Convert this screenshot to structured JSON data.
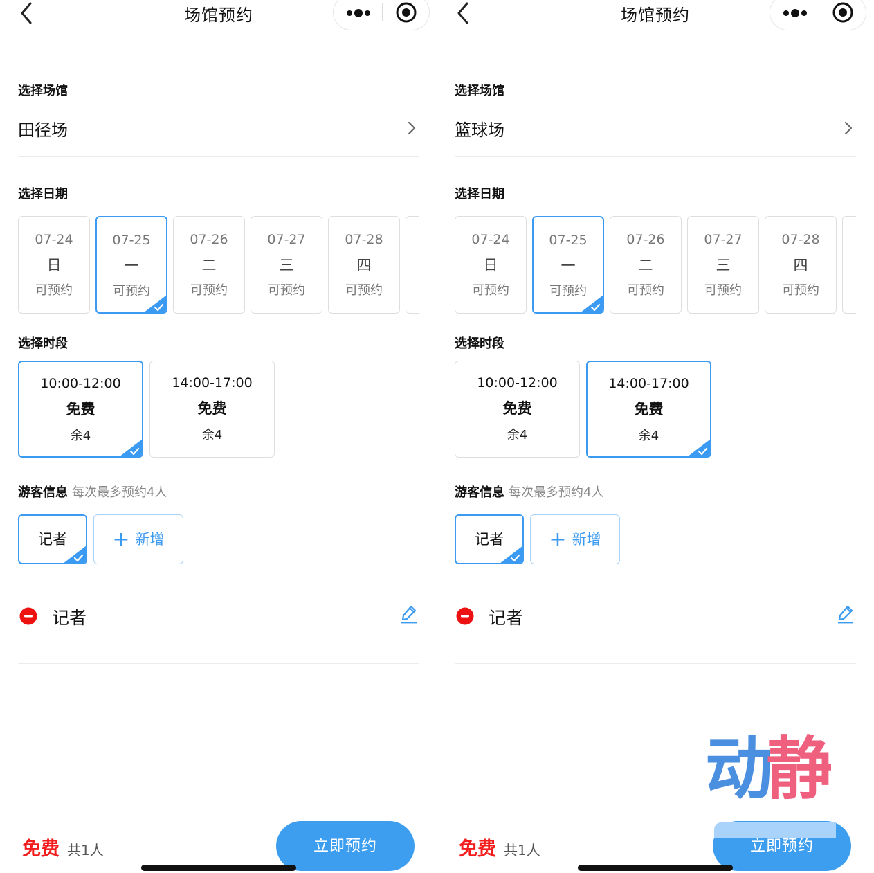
{
  "panels": [
    {
      "nav": {
        "title": "场馆预约",
        "back_icon": "chevron-left-icon",
        "more_icon": "more-dots-icon",
        "close_icon": "target-icon"
      },
      "venue": {
        "label": "选择场馆",
        "value": "田径场"
      },
      "date": {
        "label": "选择日期",
        "items": [
          {
            "date": "07-24",
            "weekday": "日",
            "status": "可预约",
            "selected": false
          },
          {
            "date": "07-25",
            "weekday": "一",
            "status": "可预约",
            "selected": true
          },
          {
            "date": "07-26",
            "weekday": "二",
            "status": "可预约",
            "selected": false
          },
          {
            "date": "07-27",
            "weekday": "三",
            "status": "可预约",
            "selected": false
          },
          {
            "date": "07-28",
            "weekday": "四",
            "status": "可预约",
            "selected": false
          }
        ]
      },
      "slot": {
        "label": "选择时段",
        "items": [
          {
            "time": "10:00-12:00",
            "price": "免费",
            "remaining": "余4",
            "selected": true
          },
          {
            "time": "14:00-17:00",
            "price": "免费",
            "remaining": "余4",
            "selected": false
          }
        ]
      },
      "visitor": {
        "label": "游客信息",
        "note": "每次最多预约4人",
        "chip": "记者",
        "add_label": "新增",
        "entry_name": "记者"
      },
      "footer": {
        "price": "免费",
        "count": "共1人",
        "button": "立即预约"
      }
    },
    {
      "nav": {
        "title": "场馆预约",
        "back_icon": "chevron-left-icon",
        "more_icon": "more-dots-icon",
        "close_icon": "target-icon"
      },
      "venue": {
        "label": "选择场馆",
        "value": "篮球场"
      },
      "date": {
        "label": "选择日期",
        "items": [
          {
            "date": "07-24",
            "weekday": "日",
            "status": "可预约",
            "selected": false
          },
          {
            "date": "07-25",
            "weekday": "一",
            "status": "可预约",
            "selected": true
          },
          {
            "date": "07-26",
            "weekday": "二",
            "status": "可预约",
            "selected": false
          },
          {
            "date": "07-27",
            "weekday": "三",
            "status": "可预约",
            "selected": false
          },
          {
            "date": "07-28",
            "weekday": "四",
            "status": "可预约",
            "selected": false
          }
        ]
      },
      "slot": {
        "label": "选择时段",
        "items": [
          {
            "time": "10:00-12:00",
            "price": "免费",
            "remaining": "余4",
            "selected": false
          },
          {
            "time": "14:00-17:00",
            "price": "免费",
            "remaining": "余4",
            "selected": true
          }
        ]
      },
      "visitor": {
        "label": "游客信息",
        "note": "每次最多预约4人",
        "chip": "记者",
        "add_label": "新增",
        "entry_name": "记者"
      },
      "footer": {
        "price": "免费",
        "count": "共1人",
        "button": "立即预约"
      }
    }
  ],
  "watermark": {
    "text": "动静"
  },
  "colors": {
    "accent": "#3b9af2",
    "price_red": "#f31d1d",
    "watermark_blue": "#4a8fe0",
    "watermark_pink": "#ef5f7e"
  }
}
